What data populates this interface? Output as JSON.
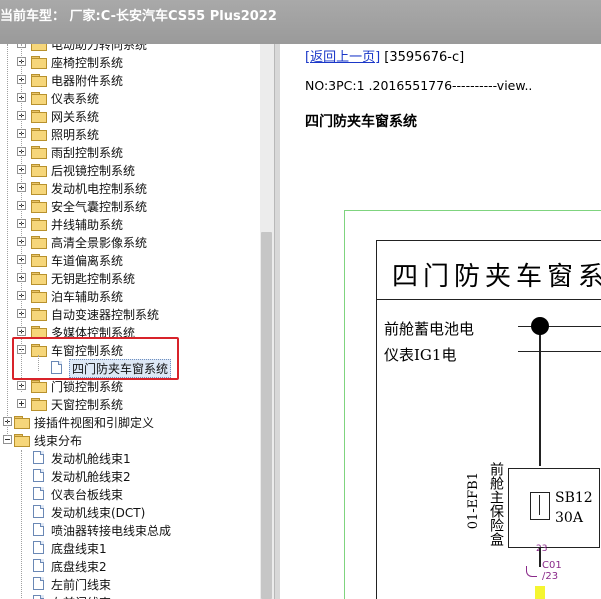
{
  "window": {
    "title": "当前车型：  厂家:C-长安汽车CS55 Plus2022"
  },
  "tree": {
    "items": [
      {
        "label": "电动助力转向系统",
        "type": "folder",
        "level": 1,
        "expand": "plus"
      },
      {
        "label": "座椅控制系统",
        "type": "folder",
        "level": 1,
        "expand": "plus"
      },
      {
        "label": "电器附件系统",
        "type": "folder",
        "level": 1,
        "expand": "plus"
      },
      {
        "label": "仪表系统",
        "type": "folder",
        "level": 1,
        "expand": "plus"
      },
      {
        "label": "网关系统",
        "type": "folder",
        "level": 1,
        "expand": "plus"
      },
      {
        "label": "照明系统",
        "type": "folder",
        "level": 1,
        "expand": "plus"
      },
      {
        "label": "雨刮控制系统",
        "type": "folder",
        "level": 1,
        "expand": "plus"
      },
      {
        "label": "后视镜控制系统",
        "type": "folder",
        "level": 1,
        "expand": "plus"
      },
      {
        "label": "发动机电控制系统",
        "type": "folder",
        "level": 1,
        "expand": "plus"
      },
      {
        "label": "安全气囊控制系统",
        "type": "folder",
        "level": 1,
        "expand": "plus"
      },
      {
        "label": "并线辅助系统",
        "type": "folder",
        "level": 1,
        "expand": "plus"
      },
      {
        "label": "高清全景影像系统",
        "type": "folder",
        "level": 1,
        "expand": "plus"
      },
      {
        "label": "车道偏离系统",
        "type": "folder",
        "level": 1,
        "expand": "plus"
      },
      {
        "label": "无钥匙控制系统",
        "type": "folder",
        "level": 1,
        "expand": "plus"
      },
      {
        "label": "泊车辅助系统",
        "type": "folder",
        "level": 1,
        "expand": "plus"
      },
      {
        "label": "自动变速器控制系统",
        "type": "folder",
        "level": 1,
        "expand": "plus"
      },
      {
        "label": "多媒体控制系统",
        "type": "folder",
        "level": 1,
        "expand": "plus"
      },
      {
        "label": "车窗控制系统",
        "type": "folder",
        "level": 1,
        "expand": "minus"
      },
      {
        "label": "四门防夹车窗系统",
        "type": "doc",
        "level": 2,
        "expand": "none",
        "selected": true
      },
      {
        "label": "门锁控制系统",
        "type": "folder",
        "level": 1,
        "expand": "plus"
      },
      {
        "label": "天窗控制系统",
        "type": "folder",
        "level": 1,
        "expand": "plus"
      },
      {
        "label": "接插件视图和引脚定义",
        "type": "folder",
        "level": 0,
        "expand": "plus"
      },
      {
        "label": "线束分布",
        "type": "folder",
        "level": 0,
        "expand": "minus"
      },
      {
        "label": "发动机舱线束1",
        "type": "doc",
        "level": 1,
        "expand": "none"
      },
      {
        "label": "发动机舱线束2",
        "type": "doc",
        "level": 1,
        "expand": "none"
      },
      {
        "label": "仪表台板线束",
        "type": "doc",
        "level": 1,
        "expand": "none"
      },
      {
        "label": "发动机线束(DCT)",
        "type": "doc",
        "level": 1,
        "expand": "none"
      },
      {
        "label": "喷油器转接电线束总成",
        "type": "doc",
        "level": 1,
        "expand": "none"
      },
      {
        "label": "底盘线束1",
        "type": "doc",
        "level": 1,
        "expand": "none"
      },
      {
        "label": "底盘线束2",
        "type": "doc",
        "level": 1,
        "expand": "none"
      },
      {
        "label": "左前门线束",
        "type": "doc",
        "level": 1,
        "expand": "none"
      },
      {
        "label": "右前门线束",
        "type": "doc",
        "level": 1,
        "expand": "none"
      }
    ]
  },
  "content": {
    "back_link": "[返回上一页]",
    "doc_id": "[3595676-c]",
    "no_line": "NO:3PC:1 .2016551776----------view..",
    "heading": "四门防夹车窗系统",
    "diagram": {
      "title": "四门防夹车窗系",
      "label1": "前舱蓄电池电",
      "label2": "仪表IG1电",
      "fuse_name": "SB12",
      "fuse_amp": "30A",
      "vlabel_id": "01-EFB1",
      "vlabel_name": "前舱主保险盒",
      "pin": "23",
      "connector": "C01",
      "connector_pin": "/23"
    }
  }
}
